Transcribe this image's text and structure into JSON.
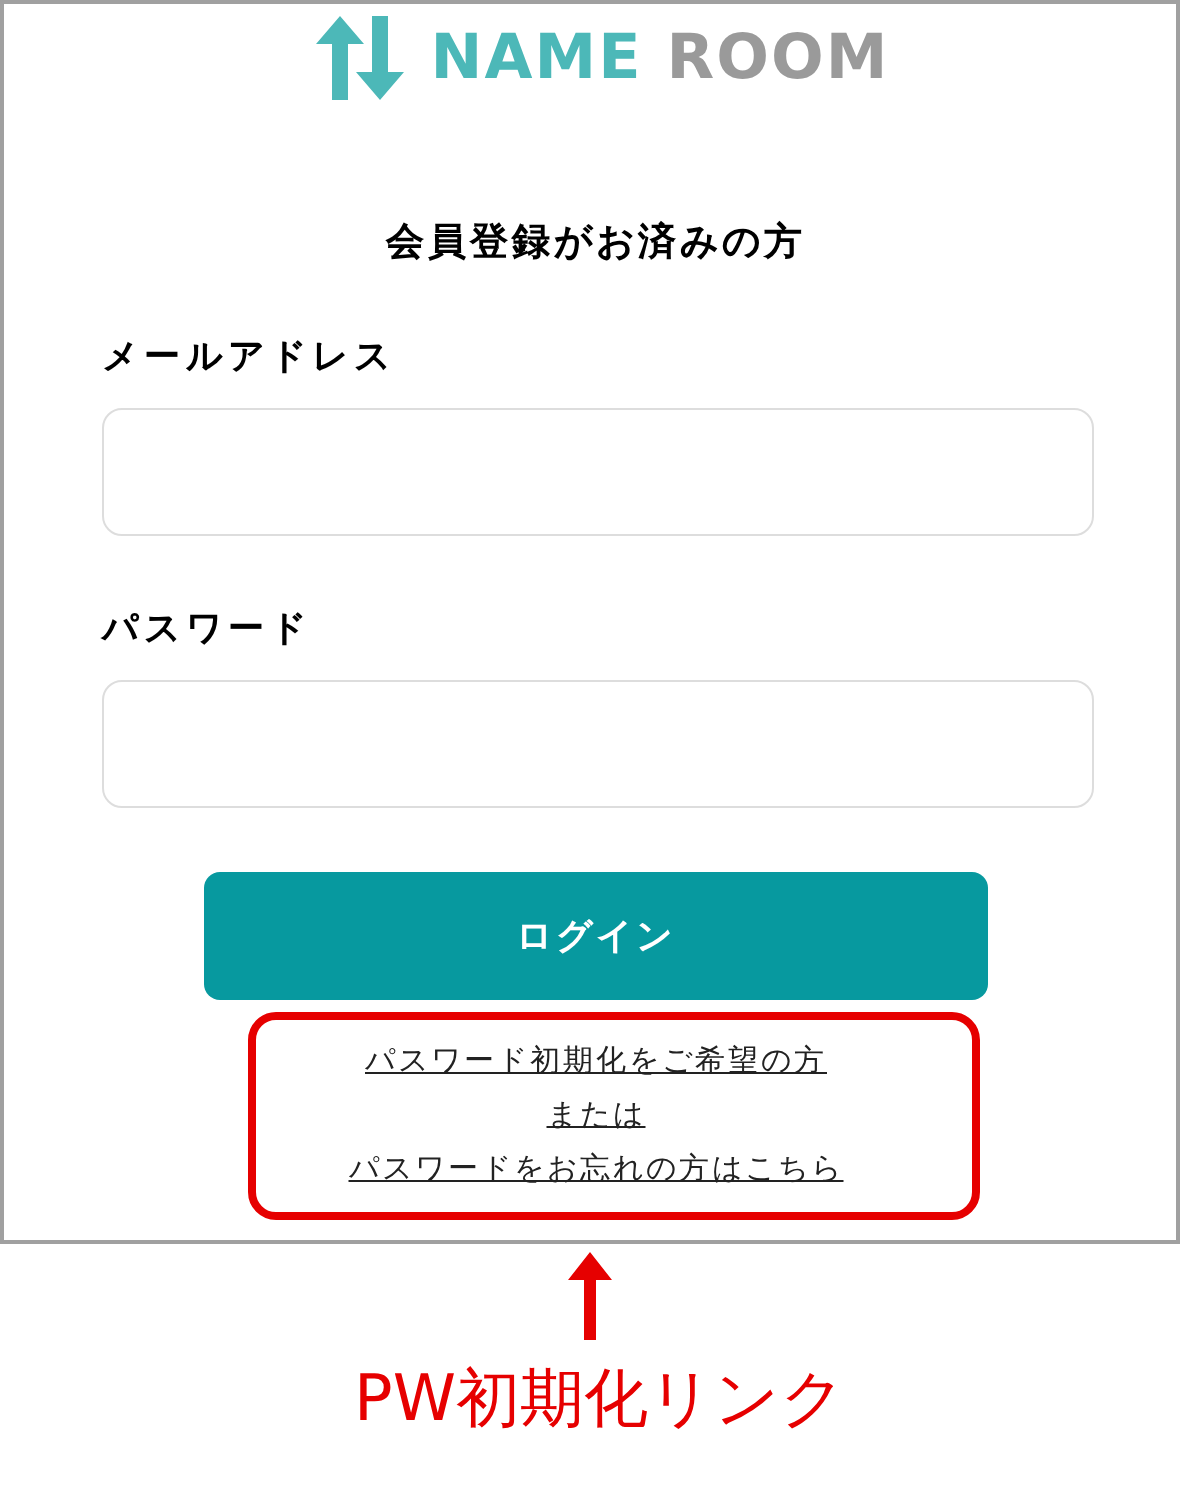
{
  "logo": {
    "words": [
      {
        "text": "NAME",
        "color": "#4cb8b8"
      },
      {
        "text": "ROOM",
        "color": "#9a9a9a"
      }
    ]
  },
  "heading": "会員登録がお済みの方",
  "fields": [
    {
      "label": "メールアドレス"
    },
    {
      "label": "パスワード"
    }
  ],
  "login_button": "ログイン",
  "links": [
    "パスワード初期化をご希望の方",
    "または",
    "パスワードをお忘れの方はこちら"
  ],
  "annotation": {
    "label": "PW初期化リンク"
  }
}
